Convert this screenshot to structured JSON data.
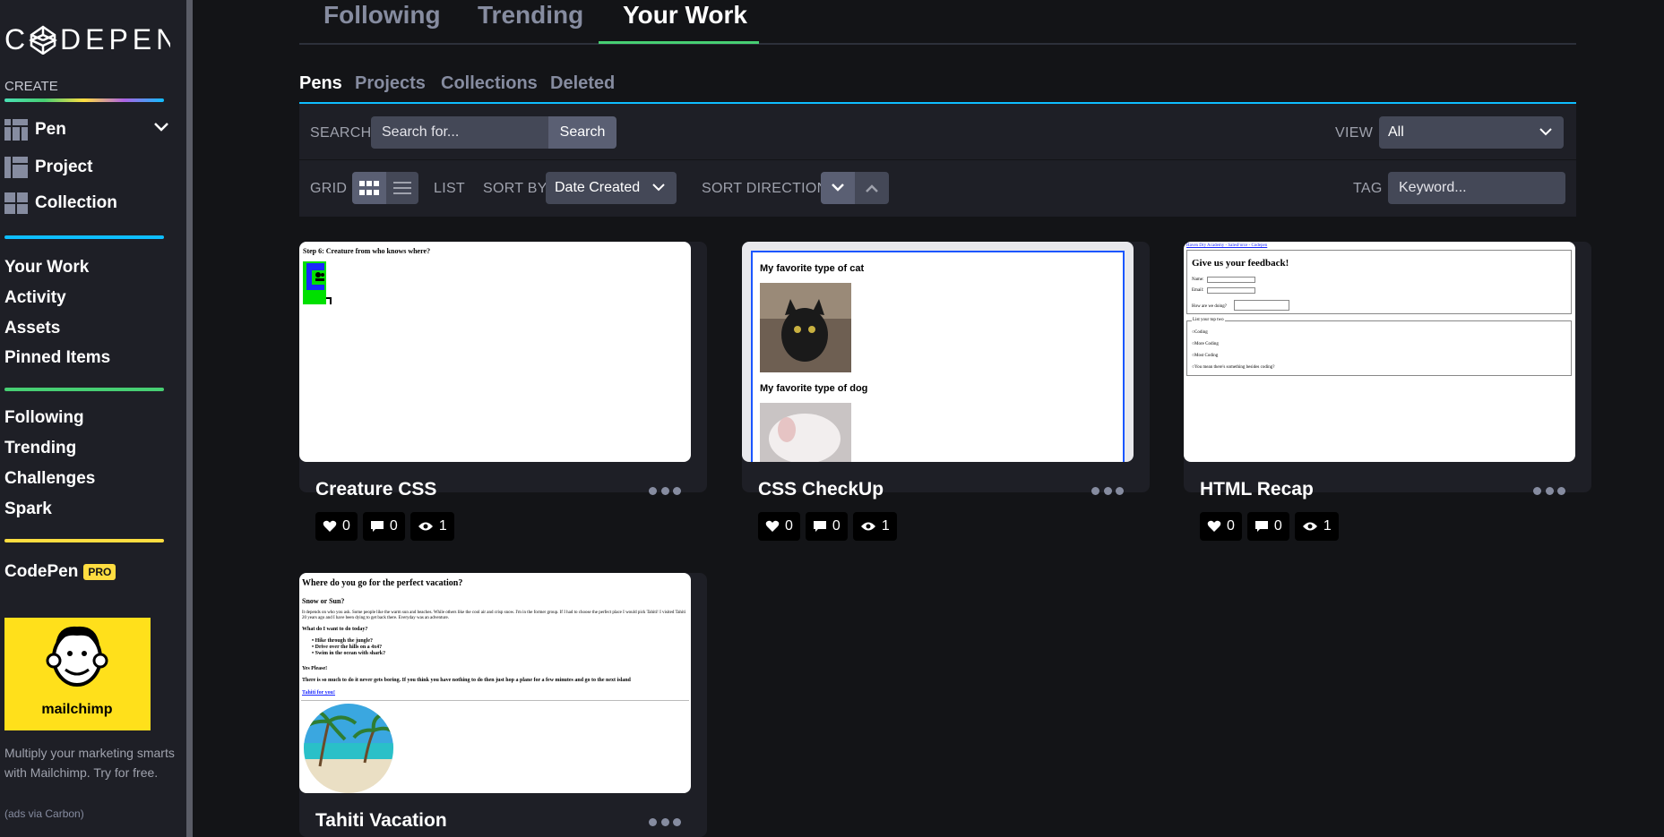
{
  "sidebar": {
    "logo_text": "CODEPEN",
    "create_label": "CREATE",
    "create_items": [
      {
        "label": "Pen",
        "icon": "pen-grid-icon"
      },
      {
        "label": "Project",
        "icon": "project-grid-icon"
      },
      {
        "label": "Collection",
        "icon": "collection-grid-icon"
      }
    ],
    "nav_primary": [
      "Your Work",
      "Activity",
      "Assets",
      "Pinned Items"
    ],
    "nav_secondary": [
      "Following",
      "Trending",
      "Challenges",
      "Spark"
    ],
    "codepen_label": "CodePen",
    "pro_badge": "PRO",
    "ad_brand": "mailchimp",
    "ad_text": "Multiply your marketing smarts with Mailchimp. Try for free.",
    "ad_via": "(ads via Carbon)",
    "colors": {
      "create_bar": "rainbow",
      "nav_bar1": "#0ebeff",
      "nav_bar2": "#47cf73",
      "nav_bar3": "#ffdd40",
      "pro": "#ffdd40",
      "ad_bg": "#ffe01b"
    }
  },
  "top_tabs": [
    "Following",
    "Trending",
    "Your Work"
  ],
  "top_tab_active": "Your Work",
  "sub_tabs": [
    "Pens",
    "Projects",
    "Collections",
    "Deleted"
  ],
  "sub_tab_active": "Pens",
  "controls": {
    "search_label": "SEARCH",
    "search_placeholder": "Search for...",
    "search_button": "Search",
    "view_label": "VIEW",
    "view_value": "All",
    "grid_label": "GRID",
    "list_label": "LIST",
    "sort_by_label": "SORT BY",
    "sort_by_value": "Date Created",
    "sort_direction_label": "SORT DIRECTION",
    "tag_label": "TAG",
    "tag_placeholder": "Keyword..."
  },
  "cards": [
    {
      "title": "Creature CSS",
      "likes": "0",
      "comments": "0",
      "views": "1",
      "preview": {
        "heading": "Step 6: Creature from who knows where?"
      }
    },
    {
      "title": "CSS CheckUp",
      "likes": "0",
      "comments": "0",
      "views": "1",
      "preview": {
        "heading1": "My favorite type of cat",
        "heading2": "My favorite type of dog"
      }
    },
    {
      "title": "HTML Recap",
      "likes": "0",
      "comments": "0",
      "views": "1",
      "preview": {
        "breadcrumb": "Haven Dry Academy - SalesForce - Codepen",
        "heading": "Give us your feedback!",
        "name": "Name:",
        "email": "Email:",
        "how": "How are we doing?",
        "legend": "List your top two",
        "options": [
          "Coding",
          "More Coding",
          "Most Coding",
          "You mean there's something besides coding?"
        ]
      }
    },
    {
      "title": "Tahiti Vacation",
      "likes": "",
      "comments": "",
      "views": "",
      "preview": {
        "heading": "Where do you go for the perfect vacation?",
        "sub": "Snow or Sun?",
        "para": "It depends on who you ask. Some people like the warm sun and beaches. While others like the cool air and crisp snow. I'm in the former group. If I had to choose the perfect place I would pick Tahiti! I visited Tahiti 20 years ago and I have been dying to get back there. Everyday was an adventure.",
        "q": "What do I want to do today?",
        "items": [
          "Hike through the jungle?",
          "Drive over the hills on a 4x4?",
          "Swim in the ocean with shark?"
        ],
        "yes": "Yes Please!",
        "boring": "There is so much to do it never gets boring. If you think you have nothing to do then just hop a plane for a few minutes and go to the next island",
        "link": "Tahiti for you!"
      }
    }
  ]
}
